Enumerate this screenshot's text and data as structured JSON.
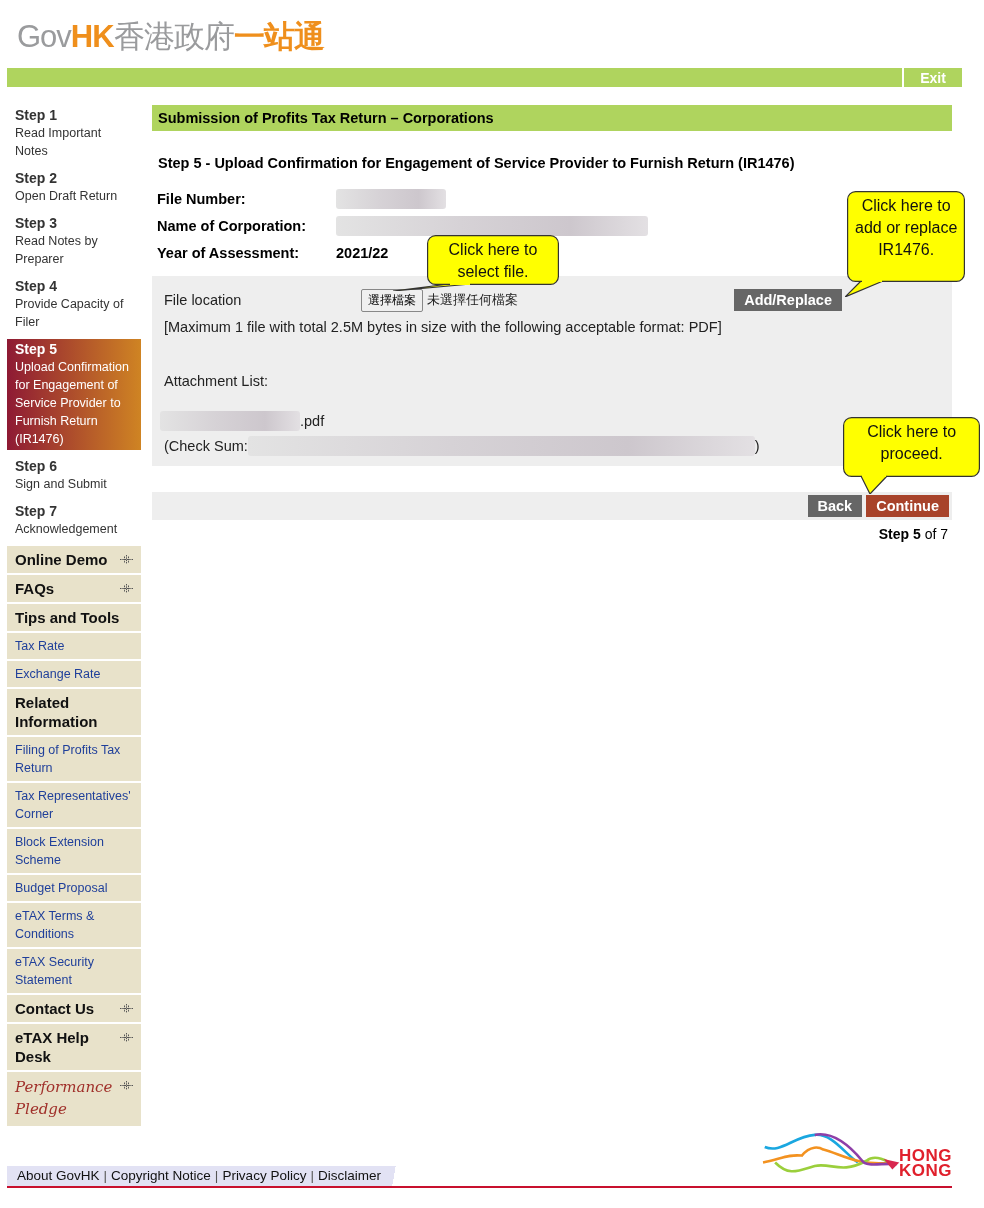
{
  "header": {
    "logo": [
      {
        "text": "Gov",
        "accent": false
      },
      {
        "text": "HK",
        "accent": true
      },
      {
        "text": "香港政府",
        "accent": false
      },
      {
        "text": "一站通",
        "accent": true
      }
    ],
    "exit": "Exit"
  },
  "steps": [
    {
      "step": "Step 1",
      "label": "Read Important Notes",
      "selected": false
    },
    {
      "step": "Step 2",
      "label": "Open Draft Return",
      "selected": false
    },
    {
      "step": "Step 3",
      "label": "Read Notes by Preparer",
      "selected": false
    },
    {
      "step": "Step 4",
      "label": "Provide Capacity of Filer",
      "selected": false
    },
    {
      "step": "Step 5",
      "label": "Upload Confirmation for Engagement of Service Provider to Furnish Return (IR1476)",
      "selected": true
    },
    {
      "step": "Step 6",
      "label": "Sign and Submit",
      "selected": false
    },
    {
      "step": "Step 7",
      "label": "Acknowledgement",
      "selected": false
    }
  ],
  "menu": [
    {
      "kind": "section",
      "label": "Online Demo",
      "expandable": true
    },
    {
      "kind": "section",
      "label": "FAQs",
      "expandable": true
    },
    {
      "kind": "section",
      "label": "Tips and Tools",
      "expandable": false
    },
    {
      "kind": "link",
      "label": "Tax Rate"
    },
    {
      "kind": "link",
      "label": "Exchange Rate"
    },
    {
      "kind": "section",
      "label": "Related Information",
      "expandable": false
    },
    {
      "kind": "link",
      "label": "Filing of Profits Tax Return"
    },
    {
      "kind": "link",
      "label": "Tax Representatives' Corner"
    },
    {
      "kind": "link",
      "label": "Block Extension Scheme"
    },
    {
      "kind": "link",
      "label": "Budget Proposal"
    },
    {
      "kind": "link",
      "label": "eTAX Terms & Conditions"
    },
    {
      "kind": "link",
      "label": "eTAX Security Statement"
    },
    {
      "kind": "section",
      "label": "Contact Us",
      "expandable": true
    },
    {
      "kind": "section",
      "label": "eTAX Help Desk",
      "expandable": true
    },
    {
      "kind": "pledge",
      "label": "Performance Pledge",
      "expandable": true
    }
  ],
  "main": {
    "title": "Submission of Profits Tax Return – Corporations",
    "step_title": "Step 5 - Upload Confirmation for Engagement of Service Provider to Furnish Return (IR1476)",
    "fields": [
      {
        "label": "File Number:",
        "redacted": true
      },
      {
        "label": "Name of Corporation:",
        "redacted": true
      },
      {
        "label": "Year of Assessment:",
        "value": "2021/22",
        "redacted": false
      }
    ],
    "upload": {
      "label": "File location",
      "choose_button": "選擇檔案",
      "file_status": "未選擇任何檔案",
      "add_button": "Add/Replace",
      "note": "[Maximum 1 file with total 2.5M bytes in size with the following acceptable format: PDF]",
      "attachment_label": "Attachment List:",
      "attachment_suffix": ".pdf",
      "checksum_prefix": "(Check Sum:",
      "checksum_suffix": ")"
    },
    "callouts": [
      "Click here to select file.",
      "Click here to add or replace IR1476.",
      "Click here to proceed."
    ],
    "buttons": {
      "back": "Back",
      "continue": "Continue"
    },
    "progress": "**Step 5** of 7"
  },
  "footer": {
    "links": [
      "About GovHK",
      "Copyright Notice",
      "Privacy Policy",
      "Disclaimer"
    ],
    "separators": [
      "|",
      "|",
      "|"
    ],
    "brand": [
      "HONG",
      "KONG"
    ]
  }
}
